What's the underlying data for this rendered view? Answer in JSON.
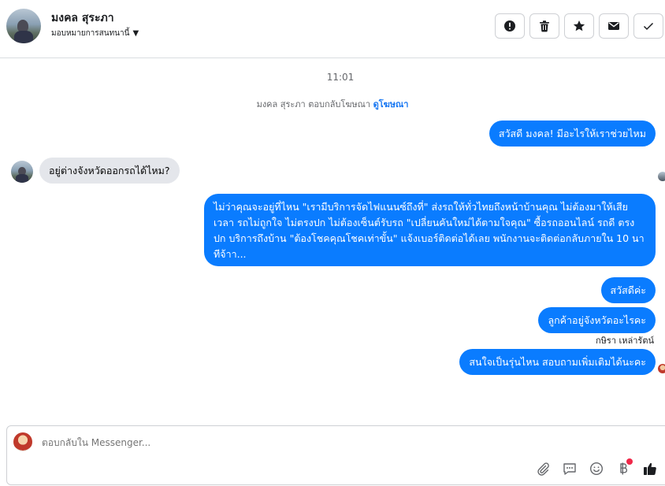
{
  "header": {
    "contact_name": "มงคล สุระภา",
    "assign_label": "มอบหมายการสนทนานี้",
    "actions": [
      {
        "id": "spam",
        "icon": "exclamation-icon"
      },
      {
        "id": "delete",
        "icon": "trash-icon"
      },
      {
        "id": "star",
        "icon": "star-icon"
      },
      {
        "id": "unread",
        "icon": "envelope-icon"
      },
      {
        "id": "done",
        "icon": "check-icon"
      }
    ]
  },
  "chat": {
    "timestamp": "11:01",
    "ad_reply_text": "มงคล สุระภา ตอบกลับโฆษณา",
    "ad_link": "ดูโฆษณา",
    "messages": [
      {
        "from": "page",
        "text": "สวัสดี มงคล! มีอะไรให้เราช่วยไหม"
      },
      {
        "from": "customer",
        "text": "อยู่ต่างจังหวัดออกรถได้ไหม?"
      },
      {
        "from": "page",
        "text": "ไม่ว่าคุณจะอยู่ที่ไหน \"เรามีบริการจัดไฟแนนซ์ถึงที่\"  ส่งรถให้ทั่วไทยถึงหน้าบ้านคุณ ไม่ต้องมาให้เสียเวลา รถไม่ถูกใจ ไม่ตรงปก ไม่ต้องเซ็นต์รับรถ \"เปลี่ยนคันใหม่ได้ตามใจคุณ\" ซื้อรถออนไลน์ รถดี ตรงปก บริการถึงบ้าน \"ต้องโชคคุณโชคเท่าขั้น\" แจ้งเบอร์ติดต่อได้เลย พนักงานจะติดต่อกลับภายใน 10 นาทีจ้าา..."
      },
      {
        "from": "page",
        "text": "สวัสดีค่ะ"
      },
      {
        "from": "page",
        "text": "ลูกค้าอยู่จังหวัดอะไรคะ"
      },
      {
        "from": "page",
        "text": "สนใจเป็นรุ่นไหน สอบถามเพิ่มเติมได้นะคะ"
      }
    ],
    "sender_label": "กษิรา เหล่ารัตน์"
  },
  "composer": {
    "placeholder": "ตอบกลับใน Messenger...",
    "tools": [
      "paperclip-icon",
      "saved-reply-icon",
      "emoji-icon",
      "baht-icon",
      "thumbs-up-icon"
    ]
  },
  "colors": {
    "outgoing_bubble": "#0a7cff",
    "incoming_bubble": "#e4e6eb",
    "link": "#1877f2",
    "notification_dot": "#f02849"
  }
}
